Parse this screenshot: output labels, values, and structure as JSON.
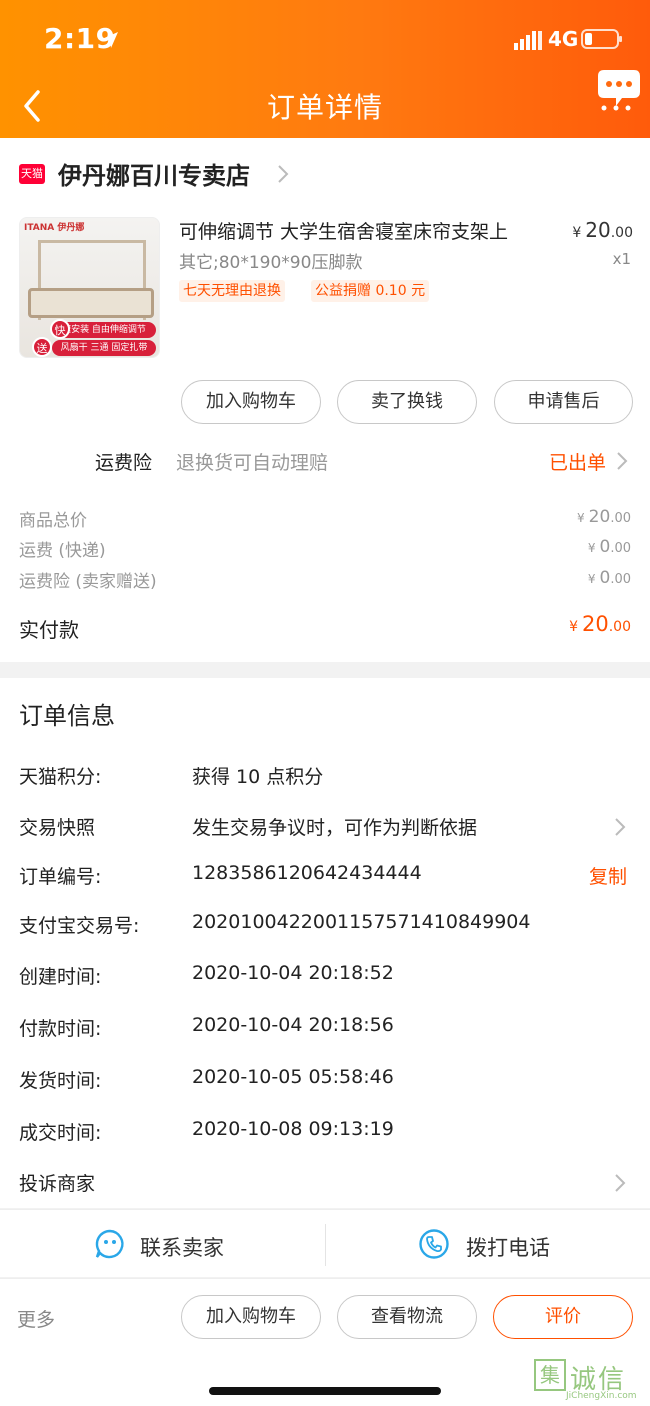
{
  "status_bar": {
    "time": "2:19",
    "network": "4G"
  },
  "nav": {
    "title": "订单详情"
  },
  "store": {
    "badge": "天猫",
    "name": "伊丹娜百川专卖店"
  },
  "product": {
    "title": "可伸缩调节 大学生宿舍寝室床帘支架上",
    "spec": "其它;80*190*90压脚款",
    "tags": [
      "七天无理由退换",
      "公益捐赠 0.10 元"
    ],
    "price_currency": "¥",
    "price_int": "20",
    "price_dec": ".00",
    "qty": "x1",
    "thumb": {
      "brand": "ITANA 伊丹娜",
      "strip1": "速安装  自由伸缩调节",
      "strip2": "风扇干  三通  固定扎带",
      "dot1": "快",
      "dot2": "送"
    }
  },
  "actions": {
    "add_cart": "加入购物车",
    "resell": "卖了换钱",
    "after_sale": "申请售后"
  },
  "insurance": {
    "label": "运费险",
    "desc": "退换货可自动理赔",
    "status": "已出单"
  },
  "fees": [
    {
      "label": "商品总价",
      "currency": "¥",
      "int": "20",
      "dec": ".00"
    },
    {
      "label": "运费 (快递)",
      "currency": "¥",
      "int": "0",
      "dec": ".00"
    },
    {
      "label": "运费险 (卖家赠送)",
      "currency": "¥",
      "int": "0",
      "dec": ".00"
    }
  ],
  "paid": {
    "label": "实付款",
    "currency": "¥",
    "int": "20",
    "dec": ".00"
  },
  "order_info": {
    "title": "订单信息",
    "rows": [
      {
        "label": "天猫积分:",
        "value": "获得 10 点积分"
      },
      {
        "label": "交易快照",
        "value": "发生交易争议时，可作为判断依据"
      },
      {
        "label": "订单编号:",
        "value": "1283586120642434444",
        "action": "复制"
      },
      {
        "label": "支付宝交易号:",
        "value": "2020100422001157571410849904"
      },
      {
        "label": "创建时间:",
        "value": "2020-10-04 20:18:52"
      },
      {
        "label": "付款时间:",
        "value": "2020-10-04 20:18:56"
      },
      {
        "label": "发货时间:",
        "value": "2020-10-05 05:58:46"
      },
      {
        "label": "成交时间:",
        "value": "2020-10-08 09:13:19"
      },
      {
        "label": "投诉商家",
        "value": ""
      }
    ]
  },
  "contact": {
    "seller": "联系卖家",
    "phone": "拨打电话"
  },
  "bottom_bar": {
    "more": "更多",
    "add_cart": "加入购物车",
    "logistics": "查看物流",
    "rate": "评价"
  },
  "watermark": {
    "glyph": "集",
    "text": "诚信",
    "sub": "JiChengXin.com"
  },
  "colors": {
    "accent": "#ff5000",
    "header_start": "#ff9200",
    "header_end": "#ff5b0b",
    "tmall_red": "#ff0036"
  }
}
